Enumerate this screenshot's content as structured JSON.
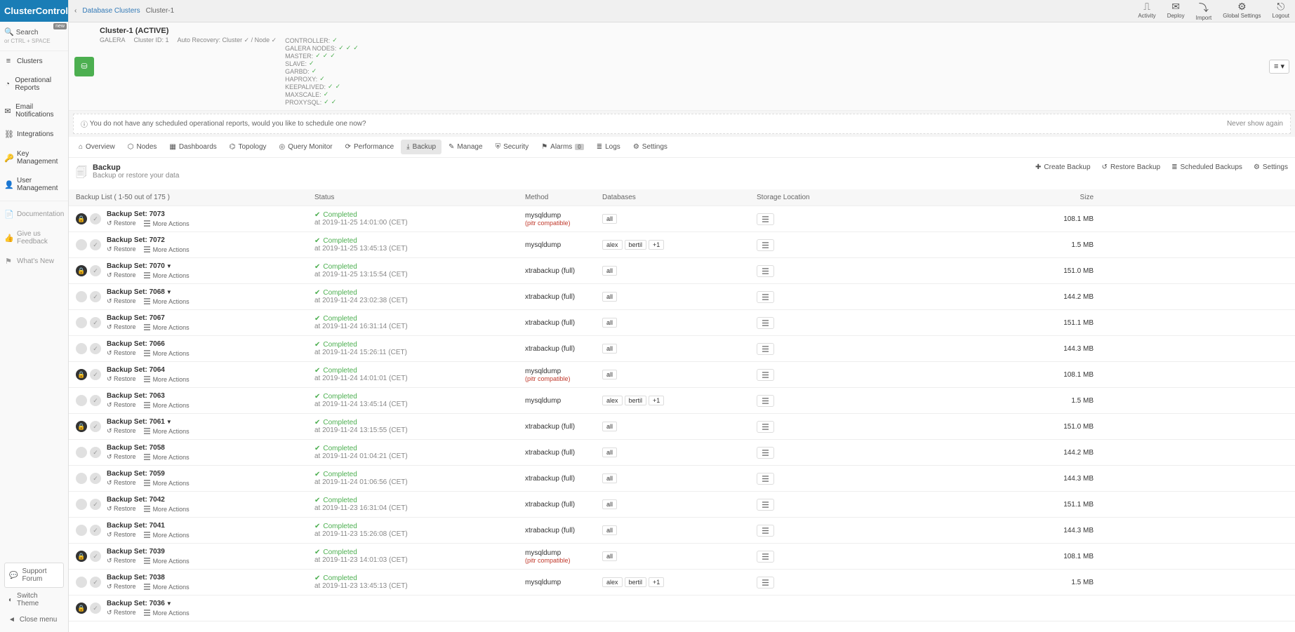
{
  "brand": "ClusterControl",
  "search": {
    "label": "Search",
    "hint": "or CTRL + SPACE"
  },
  "new_badge": "new",
  "nav_main": [
    {
      "icon": "≡",
      "label": "Clusters"
    },
    {
      "icon": "◔",
      "label": "Operational Reports"
    },
    {
      "icon": "✉",
      "label": "Email Notifications"
    },
    {
      "icon": "⛓",
      "label": "Integrations"
    },
    {
      "icon": "🔑",
      "label": "Key Management"
    },
    {
      "icon": "👤",
      "label": "User Management"
    }
  ],
  "nav_secondary": [
    {
      "icon": "📄",
      "label": "Documentation"
    },
    {
      "icon": "👍",
      "label": "Give us Feedback"
    },
    {
      "icon": "⚑",
      "label": "What's New"
    }
  ],
  "footer": {
    "support": "Support Forum",
    "theme": "Switch Theme",
    "close": "Close menu"
  },
  "breadcrumb": {
    "back": "‹",
    "parent": "Database Clusters",
    "current": "Cluster-1"
  },
  "top_actions": [
    {
      "icon": "⎍",
      "label": "Activity"
    },
    {
      "icon": "✉",
      "label": "Deploy"
    },
    {
      "icon": "⤵",
      "label": "Import"
    },
    {
      "icon": "⚙",
      "label": "Global Settings"
    },
    {
      "icon": "⎋",
      "label": "Logout"
    }
  ],
  "cluster": {
    "title": "Cluster-1 (ACTIVE)",
    "type": "GALERA",
    "id_label": "Cluster ID: 1",
    "auto_recovery": "Auto Recovery: Cluster ✓ / Node ✓",
    "status": [
      {
        "label": "CONTROLLER:",
        "checks": 1
      },
      {
        "label": "GALERA NODES:",
        "checks": 3
      },
      {
        "label": "MASTER:",
        "checks": 3
      },
      {
        "label": "SLAVE:",
        "checks": 1
      },
      {
        "label": "GARBD:",
        "checks": 1
      },
      {
        "label": "HAPROXY:",
        "checks": 1
      },
      {
        "label": "KEEPALIVED:",
        "checks": 2
      },
      {
        "label": "MAXSCALE:",
        "checks": 1
      },
      {
        "label": "PROXYSQL:",
        "checks": 2
      }
    ]
  },
  "banner": {
    "text": "You do not have any scheduled operational reports, would you like to schedule one now?",
    "dismiss": "Never show again"
  },
  "tabs": [
    {
      "icon": "⌂",
      "label": "Overview"
    },
    {
      "icon": "⬡",
      "label": "Nodes"
    },
    {
      "icon": "▦",
      "label": "Dashboards"
    },
    {
      "icon": "⌬",
      "label": "Topology"
    },
    {
      "icon": "◎",
      "label": "Query Monitor"
    },
    {
      "icon": "⟳",
      "label": "Performance"
    },
    {
      "icon": "⤓",
      "label": "Backup",
      "active": true
    },
    {
      "icon": "✎",
      "label": "Manage"
    },
    {
      "icon": "⛨",
      "label": "Security"
    },
    {
      "icon": "⚑",
      "label": "Alarms",
      "badge": "0"
    },
    {
      "icon": "≣",
      "label": "Logs"
    },
    {
      "icon": "⚙",
      "label": "Settings"
    }
  ],
  "page": {
    "title": "Backup",
    "subtitle": "Backup or restore your data",
    "actions": [
      {
        "icon": "✚",
        "label": "Create Backup"
      },
      {
        "icon": "↺",
        "label": "Restore Backup"
      },
      {
        "icon": "≣",
        "label": "Scheduled Backups"
      },
      {
        "icon": "⚙",
        "label": "Settings"
      }
    ]
  },
  "table": {
    "list_label": "Backup List ( 1-50 out of 175 )",
    "headers": {
      "status": "Status",
      "method": "Method",
      "db": "Databases",
      "storage": "Storage Location",
      "size": "Size"
    },
    "row_labels": {
      "restore": "Restore",
      "more": "More Actions",
      "pitr": "(pitr compatible)",
      "completed": "Completed",
      "at": "at"
    }
  },
  "rows": [
    {
      "lock": true,
      "name": "Backup Set: 7073",
      "caret": false,
      "time": "2019-11-25 14:01:00 (CET)",
      "method": "mysqldump",
      "pitr": true,
      "db": [
        "all"
      ],
      "size": "108.1 MB"
    },
    {
      "lock": false,
      "name": "Backup Set: 7072",
      "caret": false,
      "time": "2019-11-25 13:45:13 (CET)",
      "method": "mysqldump",
      "pitr": false,
      "db": [
        "alex",
        "bertil",
        "+1"
      ],
      "size": "1.5 MB"
    },
    {
      "lock": true,
      "name": "Backup Set: 7070",
      "caret": true,
      "time": "2019-11-25 13:15:54 (CET)",
      "method": "xtrabackup (full)",
      "pitr": false,
      "db": [
        "all"
      ],
      "size": "151.0 MB"
    },
    {
      "lock": false,
      "name": "Backup Set: 7068",
      "caret": true,
      "time": "2019-11-24 23:02:38 (CET)",
      "method": "xtrabackup (full)",
      "pitr": false,
      "db": [
        "all"
      ],
      "size": "144.2 MB"
    },
    {
      "lock": false,
      "name": "Backup Set: 7067",
      "caret": false,
      "time": "2019-11-24 16:31:14 (CET)",
      "method": "xtrabackup (full)",
      "pitr": false,
      "db": [
        "all"
      ],
      "size": "151.1 MB"
    },
    {
      "lock": false,
      "name": "Backup Set: 7066",
      "caret": false,
      "time": "2019-11-24 15:26:11 (CET)",
      "method": "xtrabackup (full)",
      "pitr": false,
      "db": [
        "all"
      ],
      "size": "144.3 MB"
    },
    {
      "lock": true,
      "name": "Backup Set: 7064",
      "caret": false,
      "time": "2019-11-24 14:01:01 (CET)",
      "method": "mysqldump",
      "pitr": true,
      "db": [
        "all"
      ],
      "size": "108.1 MB"
    },
    {
      "lock": false,
      "name": "Backup Set: 7063",
      "caret": false,
      "time": "2019-11-24 13:45:14 (CET)",
      "method": "mysqldump",
      "pitr": false,
      "db": [
        "alex",
        "bertil",
        "+1"
      ],
      "size": "1.5 MB"
    },
    {
      "lock": true,
      "name": "Backup Set: 7061",
      "caret": true,
      "time": "2019-11-24 13:15:55 (CET)",
      "method": "xtrabackup (full)",
      "pitr": false,
      "db": [
        "all"
      ],
      "size": "151.0 MB"
    },
    {
      "lock": false,
      "name": "Backup Set: 7058",
      "caret": false,
      "time": "2019-11-24 01:04:21 (CET)",
      "method": "xtrabackup (full)",
      "pitr": false,
      "db": [
        "all"
      ],
      "size": "144.2 MB"
    },
    {
      "lock": false,
      "name": "Backup Set: 7059",
      "caret": false,
      "time": "2019-11-24 01:06:56 (CET)",
      "method": "xtrabackup (full)",
      "pitr": false,
      "db": [
        "all"
      ],
      "size": "144.3 MB"
    },
    {
      "lock": false,
      "name": "Backup Set: 7042",
      "caret": false,
      "time": "2019-11-23 16:31:04 (CET)",
      "method": "xtrabackup (full)",
      "pitr": false,
      "db": [
        "all"
      ],
      "size": "151.1 MB"
    },
    {
      "lock": false,
      "name": "Backup Set: 7041",
      "caret": false,
      "time": "2019-11-23 15:26:08 (CET)",
      "method": "xtrabackup (full)",
      "pitr": false,
      "db": [
        "all"
      ],
      "size": "144.3 MB"
    },
    {
      "lock": true,
      "name": "Backup Set: 7039",
      "caret": false,
      "time": "2019-11-23 14:01:03 (CET)",
      "method": "mysqldump",
      "pitr": true,
      "db": [
        "all"
      ],
      "size": "108.1 MB"
    },
    {
      "lock": false,
      "name": "Backup Set: 7038",
      "caret": false,
      "time": "2019-11-23 13:45:13 (CET)",
      "method": "mysqldump",
      "pitr": false,
      "db": [
        "alex",
        "bertil",
        "+1"
      ],
      "size": "1.5 MB"
    },
    {
      "lock": true,
      "name": "Backup Set: 7036",
      "caret": true,
      "time": "",
      "method": "",
      "pitr": false,
      "db": [],
      "size": ""
    }
  ]
}
